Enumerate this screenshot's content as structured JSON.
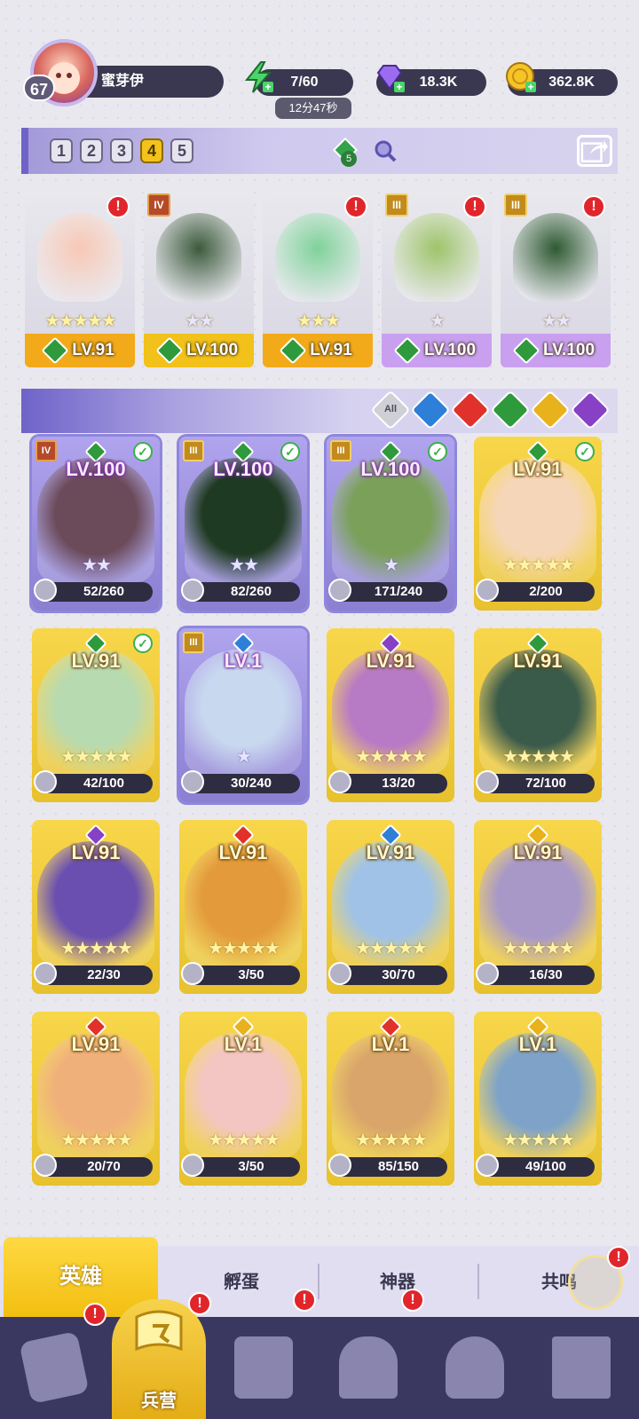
{
  "player": {
    "level": "67",
    "name": "蜜芽伊"
  },
  "resources": {
    "energy": "7/60",
    "energy_timer": "12分47秒",
    "gems": "18.3K",
    "gold": "362.8K"
  },
  "team_tabs": [
    "1",
    "2",
    "3",
    "4",
    "5"
  ],
  "team_tab_active": "4",
  "team_gem_count": "5",
  "team": [
    {
      "level": "LV.91",
      "stars": "★★★★★",
      "rank": "",
      "color": "#f2aa1a",
      "char_color": "#f7c8b5"
    },
    {
      "level": "LV.100",
      "stars": "★★",
      "rank": "IV",
      "color": "#f2c11a",
      "char_color": "#3c5a3c"
    },
    {
      "level": "LV.91",
      "stars": "★★★",
      "rank": "",
      "color": "#f2aa1a",
      "char_color": "#7fd29a"
    },
    {
      "level": "LV.100",
      "stars": "★",
      "rank": "III",
      "color": "#c9a0f0",
      "char_color": "#9ec46a"
    },
    {
      "level": "LV.100",
      "stars": "★★",
      "rank": "III",
      "color": "#c9a0f0",
      "char_color": "#2e5a32"
    }
  ],
  "filters": {
    "all": "All",
    "colors": [
      "#2e7fd8",
      "#e0322b",
      "#2f9a3c",
      "#e8b21d",
      "#8840c4"
    ]
  },
  "heroes": [
    {
      "level": "LV.100",
      "stars": "★★",
      "progress": "52/260",
      "rank": "IV",
      "check": true,
      "elem": "#2f9a3c",
      "style": "purple",
      "portrait": "#6b4a5a"
    },
    {
      "level": "LV.100",
      "stars": "★★",
      "progress": "82/260",
      "rank": "III",
      "check": true,
      "elem": "#2f9a3c",
      "style": "purple",
      "portrait": "#1f3a22"
    },
    {
      "level": "LV.100",
      "stars": "★",
      "progress": "171/240",
      "rank": "III",
      "check": true,
      "elem": "#2f9a3c",
      "style": "purple",
      "portrait": "#7aa05a"
    },
    {
      "level": "LV.91",
      "stars": "★★★★★",
      "progress": "2/200",
      "rank": "",
      "check": true,
      "elem": "#2f9a3c",
      "style": "gold",
      "portrait": "#f6d6b8"
    },
    {
      "level": "LV.91",
      "stars": "★★★★★",
      "progress": "42/100",
      "rank": "",
      "check": true,
      "elem": "#2f9a3c",
      "style": "gold",
      "portrait": "#b8dab0"
    },
    {
      "level": "LV.1",
      "stars": "★",
      "progress": "30/240",
      "rank": "III",
      "check": false,
      "elem": "#2e7fd8",
      "style": "purple",
      "portrait": "#c8d8ef"
    },
    {
      "level": "LV.91",
      "stars": "★★★★★",
      "progress": "13/20",
      "rank": "",
      "check": false,
      "elem": "#8840c4",
      "style": "gold",
      "portrait": "#b77ac4"
    },
    {
      "level": "LV.91",
      "stars": "★★★★★",
      "progress": "72/100",
      "rank": "",
      "check": false,
      "elem": "#2f9a3c",
      "style": "gold",
      "portrait": "#3b5b4a"
    },
    {
      "level": "LV.91",
      "stars": "★★★★★",
      "progress": "22/30",
      "rank": "",
      "check": false,
      "elem": "#8840c4",
      "style": "gold",
      "portrait": "#6a4fb0"
    },
    {
      "level": "LV.91",
      "stars": "★★★★★",
      "progress": "3/50",
      "rank": "",
      "check": false,
      "elem": "#e0322b",
      "style": "gold",
      "portrait": "#e39a3a"
    },
    {
      "level": "LV.91",
      "stars": "★★★★★",
      "progress": "30/70",
      "rank": "",
      "check": false,
      "elem": "#2e7fd8",
      "style": "gold",
      "portrait": "#9fc2e6"
    },
    {
      "level": "LV.91",
      "stars": "★★★★★",
      "progress": "16/30",
      "rank": "",
      "check": false,
      "elem": "#e8b21d",
      "style": "gold",
      "portrait": "#a898c8"
    },
    {
      "level": "LV.91",
      "stars": "★★★★★",
      "progress": "20/70",
      "rank": "",
      "check": false,
      "elem": "#e0322b",
      "style": "gold",
      "portrait": "#f0b07a"
    },
    {
      "level": "LV.1",
      "stars": "★★★★★",
      "progress": "3/50",
      "rank": "",
      "check": false,
      "elem": "#e8b21d",
      "style": "gold",
      "portrait": "#f3c6c4"
    },
    {
      "level": "LV.1",
      "stars": "★★★★★",
      "progress": "85/150",
      "rank": "",
      "check": false,
      "elem": "#e0322b",
      "style": "gold",
      "portrait": "#d9a56a"
    },
    {
      "level": "LV.1",
      "stars": "★★★★★",
      "progress": "49/100",
      "rank": "",
      "check": false,
      "elem": "#e8b21d",
      "style": "gold",
      "portrait": "#7fa3c8"
    }
  ],
  "sub_tabs": [
    "英雄",
    "孵蛋",
    "神器",
    "共鸣"
  ],
  "nav": {
    "active_label": "兵营"
  }
}
